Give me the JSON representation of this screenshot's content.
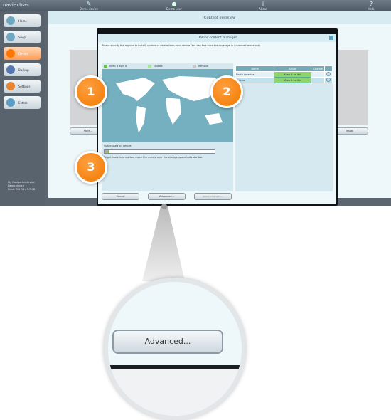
{
  "app": {
    "logo": "naviextras",
    "toolbar": [
      {
        "label": "Demo device",
        "icon": "device-icon"
      },
      {
        "label": "Demo user",
        "icon": "user-icon"
      },
      {
        "label": "About",
        "icon": "info-icon"
      },
      {
        "label": "Help",
        "icon": "help-icon"
      }
    ]
  },
  "sidebar": {
    "items": [
      {
        "label": "Home",
        "icon": "home-icon"
      },
      {
        "label": "Shop",
        "icon": "shop-icon"
      },
      {
        "label": "Device",
        "icon": "device-icon",
        "active": true
      },
      {
        "label": "Backup",
        "icon": "backup-icon"
      },
      {
        "label": "Settings",
        "icon": "settings-icon"
      },
      {
        "label": "Extras",
        "icon": "star-icon"
      }
    ],
    "device_info": [
      "My Navigation device",
      "Demo device",
      "Flash: 3.4 GB / 3.7 GB"
    ]
  },
  "main": {
    "title": "Content overview",
    "more_label": "More...",
    "install_label": "Install"
  },
  "dialog": {
    "title": "Device content manager",
    "description": "Please specify the regions to install, update or delete from your device. You can fine tune the coverage in Advanced mode only.",
    "legend": [
      {
        "label": "Keep it as it is",
        "color": "#6cc04a"
      },
      {
        "label": "Update",
        "color": "#a8e890"
      },
      {
        "label": "Remove",
        "color": "#c8c8c8"
      }
    ],
    "space_label": "Space used on device:",
    "space_used_percent": 4,
    "space_hint": "To get more information, move the mouse over the storage space indicator bar.",
    "table": {
      "headers": [
        "Name",
        "Action",
        "Change",
        ""
      ],
      "rows": [
        {
          "name": "North America",
          "action": "Keep it as it is"
        },
        {
          "name": "...dena",
          "action": "Keep it as it is"
        }
      ]
    },
    "buttons": {
      "cancel": "Cancel",
      "advanced": "Advanced...",
      "apply": "Apply changes..."
    }
  },
  "badges": [
    "1",
    "2",
    "3"
  ],
  "zoom": {
    "button_label": "Advanced..."
  }
}
